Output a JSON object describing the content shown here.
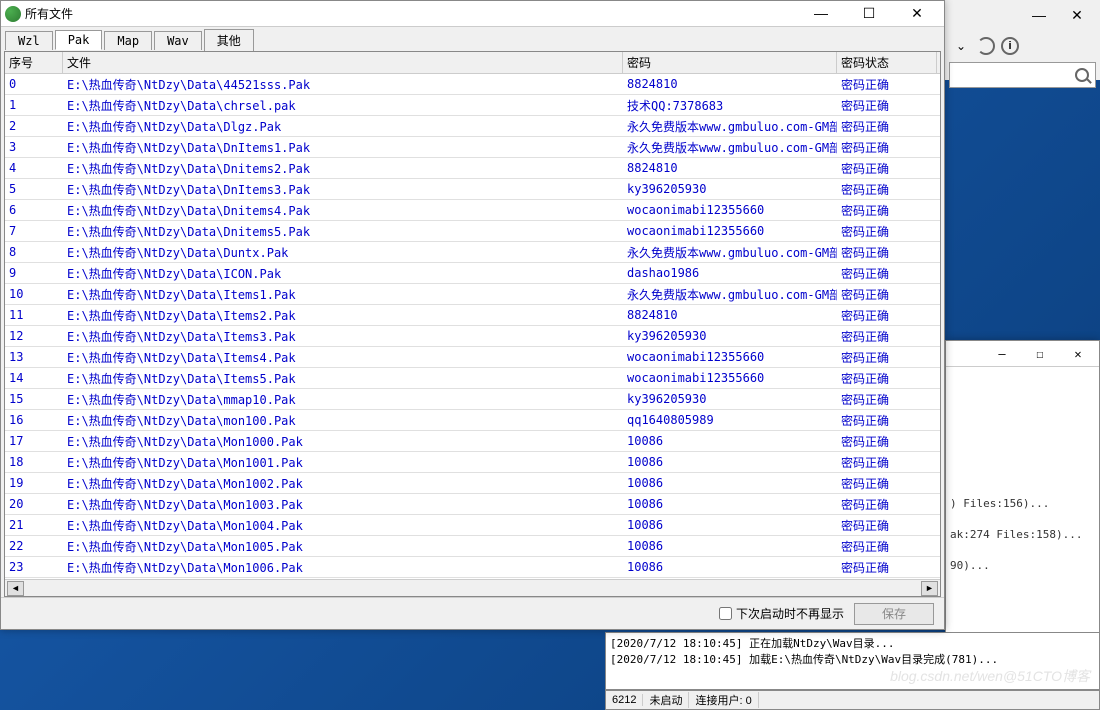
{
  "window": {
    "title": "所有文件",
    "min": "—",
    "max": "☐",
    "close": "✕"
  },
  "tabs": [
    "Wzl",
    "Pak",
    "Map",
    "Wav",
    "其他"
  ],
  "active_tab": 1,
  "columns": {
    "c0": "序号",
    "c1": "文件",
    "c2": "密码",
    "c3": "密码状态"
  },
  "rows": [
    {
      "n": "0",
      "f": "E:\\热血传奇\\NtDzy\\Data\\44521sss.Pak",
      "p": "8824810",
      "s": "密码正确"
    },
    {
      "n": "1",
      "f": "E:\\热血传奇\\NtDzy\\Data\\chrsel.pak",
      "p": "技术QQ:7378683",
      "s": "密码正确"
    },
    {
      "n": "2",
      "f": "E:\\热血传奇\\NtDzy\\Data\\Dlgz.Pak",
      "p": "永久免费版本www.gmbuluo.com-GM部落-",
      "s": "密码正确"
    },
    {
      "n": "3",
      "f": "E:\\热血传奇\\NtDzy\\Data\\DnItems1.Pak",
      "p": "永久免费版本www.gmbuluo.com-GM部落-",
      "s": "密码正确"
    },
    {
      "n": "4",
      "f": "E:\\热血传奇\\NtDzy\\Data\\Dnitems2.Pak",
      "p": "8824810",
      "s": "密码正确"
    },
    {
      "n": "5",
      "f": "E:\\热血传奇\\NtDzy\\Data\\DnItems3.Pak",
      "p": "ky396205930",
      "s": "密码正确"
    },
    {
      "n": "6",
      "f": "E:\\热血传奇\\NtDzy\\Data\\Dnitems4.Pak",
      "p": "wocaonimabi12355660",
      "s": "密码正确"
    },
    {
      "n": "7",
      "f": "E:\\热血传奇\\NtDzy\\Data\\Dnitems5.Pak",
      "p": "wocaonimabi12355660",
      "s": "密码正确"
    },
    {
      "n": "8",
      "f": "E:\\热血传奇\\NtDzy\\Data\\Duntx.Pak",
      "p": "永久免费版本www.gmbuluo.com-GM部落-",
      "s": "密码正确"
    },
    {
      "n": "9",
      "f": "E:\\热血传奇\\NtDzy\\Data\\ICON.Pak",
      "p": "dashao1986",
      "s": "密码正确"
    },
    {
      "n": "10",
      "f": "E:\\热血传奇\\NtDzy\\Data\\Items1.Pak",
      "p": "永久免费版本www.gmbuluo.com-GM部落-",
      "s": "密码正确"
    },
    {
      "n": "11",
      "f": "E:\\热血传奇\\NtDzy\\Data\\Items2.Pak",
      "p": "8824810",
      "s": "密码正确"
    },
    {
      "n": "12",
      "f": "E:\\热血传奇\\NtDzy\\Data\\Items3.Pak",
      "p": "ky396205930",
      "s": "密码正确"
    },
    {
      "n": "13",
      "f": "E:\\热血传奇\\NtDzy\\Data\\Items4.Pak",
      "p": "wocaonimabi12355660",
      "s": "密码正确"
    },
    {
      "n": "14",
      "f": "E:\\热血传奇\\NtDzy\\Data\\Items5.Pak",
      "p": "wocaonimabi12355660",
      "s": "密码正确"
    },
    {
      "n": "15",
      "f": "E:\\热血传奇\\NtDzy\\Data\\mmap10.Pak",
      "p": "ky396205930",
      "s": "密码正确"
    },
    {
      "n": "16",
      "f": "E:\\热血传奇\\NtDzy\\Data\\mon100.Pak",
      "p": "qq1640805989",
      "s": "密码正确"
    },
    {
      "n": "17",
      "f": "E:\\热血传奇\\NtDzy\\Data\\Mon1000.Pak",
      "p": "10086",
      "s": "密码正确"
    },
    {
      "n": "18",
      "f": "E:\\热血传奇\\NtDzy\\Data\\Mon1001.Pak",
      "p": "10086",
      "s": "密码正确"
    },
    {
      "n": "19",
      "f": "E:\\热血传奇\\NtDzy\\Data\\Mon1002.Pak",
      "p": "10086",
      "s": "密码正确"
    },
    {
      "n": "20",
      "f": "E:\\热血传奇\\NtDzy\\Data\\Mon1003.Pak",
      "p": "10086",
      "s": "密码正确"
    },
    {
      "n": "21",
      "f": "E:\\热血传奇\\NtDzy\\Data\\Mon1004.Pak",
      "p": "10086",
      "s": "密码正确"
    },
    {
      "n": "22",
      "f": "E:\\热血传奇\\NtDzy\\Data\\Mon1005.Pak",
      "p": "10086",
      "s": "密码正确"
    },
    {
      "n": "23",
      "f": "E:\\热血传奇\\NtDzy\\Data\\Mon1006.Pak",
      "p": "10086",
      "s": "密码正确"
    }
  ],
  "footer": {
    "checkbox_label": "下次启动时不再显示",
    "save_label": "保存"
  },
  "sec_window": {
    "lines": [
      ") Files:156)...",
      "ak:274 Files:158)...",
      "90)..."
    ]
  },
  "log": {
    "l1": "[2020/7/12 18:10:45] 正在加载NtDzy\\Wav目录...",
    "l2": "[2020/7/12 18:10:45] 加载E:\\热血传奇\\NtDzy\\Wav目录完成(781)..."
  },
  "status": {
    "s1": "6212",
    "s2": "未启动",
    "s3": "连接用户: 0"
  },
  "watermark": "blog.csdn.net/wen@51CTO博客"
}
